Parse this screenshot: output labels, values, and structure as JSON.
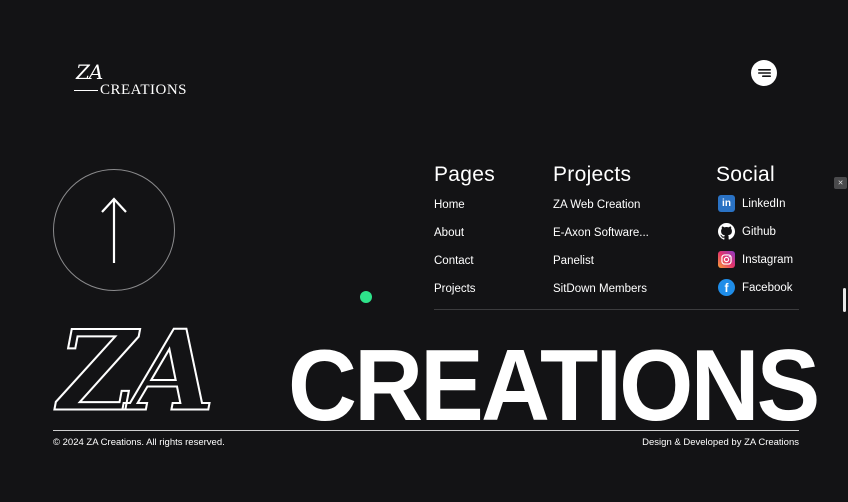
{
  "brand": {
    "logo_top": "ZA",
    "logo_bottom": "CREATIONS"
  },
  "pages": {
    "title": "Pages",
    "items": [
      "Home",
      "About",
      "Contact",
      "Projects"
    ]
  },
  "projects": {
    "title": "Projects",
    "items": [
      "ZA Web Creation",
      "E-Axon Software...",
      "Panelist",
      "SitDown Members"
    ]
  },
  "social": {
    "title": "Social",
    "items": [
      {
        "label": "LinkedIn",
        "icon": "linkedin-icon",
        "color": "#2a72c4"
      },
      {
        "label": "Github",
        "icon": "github-icon",
        "color": "#ffffff"
      },
      {
        "label": "Instagram",
        "icon": "instagram-icon",
        "color": "#d6287a"
      },
      {
        "label": "Facebook",
        "icon": "facebook-icon",
        "color": "#1f8de8"
      }
    ]
  },
  "hero": {
    "script_text": "ZA",
    "block_text": "CREATIONS"
  },
  "footer": {
    "copyright": "© 2024 ZA Creations. All rights reserved.",
    "credit": "Design & Developed by ZA Creations"
  },
  "colors": {
    "background": "#131315",
    "accent_dot": "#2ee38a"
  }
}
